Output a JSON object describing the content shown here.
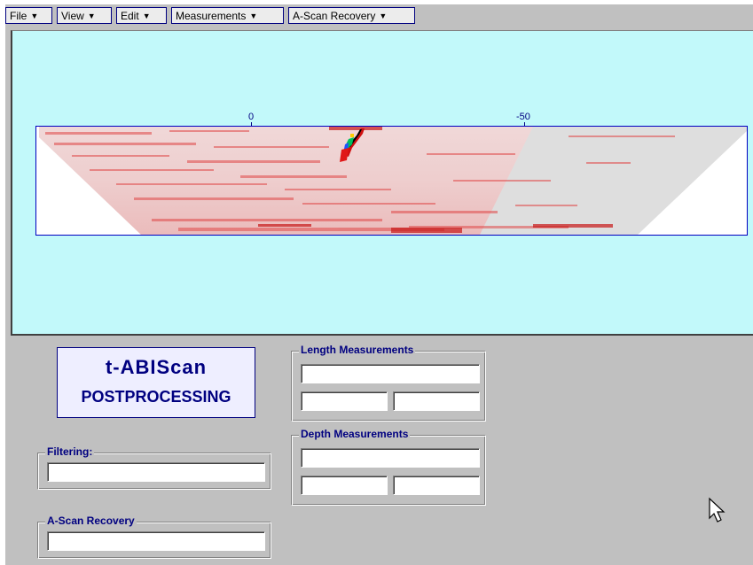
{
  "menu": {
    "file": "File",
    "view": "View",
    "edit": "Edit",
    "measurements": "Measurements",
    "ascan_recovery": "A-Scan Recovery"
  },
  "scan": {
    "axis_ticks": [
      "0",
      "-50"
    ]
  },
  "logo": {
    "line1": "t-ABIScan",
    "line2": "POSTPROCESSING"
  },
  "length_measurements": {
    "title": "Length Measurements",
    "value_main": "",
    "value_left": "",
    "value_right": ""
  },
  "depth_measurements": {
    "title": "Depth Measurements",
    "value_main": "",
    "value_left": "",
    "value_right": ""
  },
  "filtering": {
    "title": "Filtering:",
    "value": ""
  },
  "ascan_recovery": {
    "title": "A-Scan Recovery",
    "value": ""
  },
  "colors": {
    "plot_background": "#c2f9fa",
    "scan_border": "#0000c0",
    "label_color": "#000080",
    "panel_background": "#c0c0c0"
  },
  "icons": [
    "menu-caret-icon",
    "mouse-pointer-icon"
  ]
}
